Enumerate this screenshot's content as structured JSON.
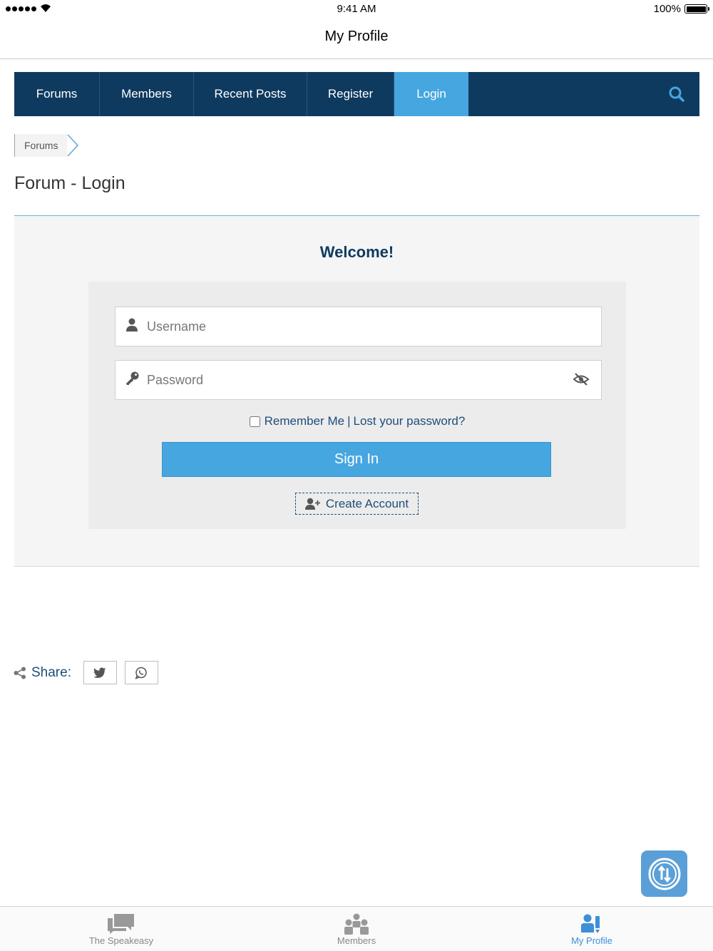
{
  "status_bar": {
    "time": "9:41 AM",
    "battery": "100%"
  },
  "nav": {
    "title": "My Profile"
  },
  "menu": {
    "items": [
      {
        "label": "Forums"
      },
      {
        "label": "Members"
      },
      {
        "label": "Recent Posts"
      },
      {
        "label": "Register"
      },
      {
        "label": "Login",
        "active": true
      }
    ]
  },
  "breadcrumb": {
    "item": "Forums"
  },
  "page": {
    "title": "Forum - Login"
  },
  "login": {
    "welcome": "Welcome!",
    "username_placeholder": "Username",
    "password_placeholder": "Password",
    "remember_label": "Remember Me",
    "separator": "|",
    "lost_password": "Lost your password?",
    "sign_in": "Sign In",
    "create_account": "Create Account"
  },
  "share": {
    "label": "Share:"
  },
  "tabs": [
    {
      "label": "The Speakeasy",
      "icon": "chat-bubbles-icon"
    },
    {
      "label": "Members",
      "icon": "group-icon"
    },
    {
      "label": "My Profile",
      "icon": "profile-icon",
      "active": true
    }
  ],
  "colors": {
    "menu_bg": "#0f3a5f",
    "accent": "#46a6e0",
    "link": "#1e4e7a",
    "tab_active": "#3d8fd8"
  }
}
